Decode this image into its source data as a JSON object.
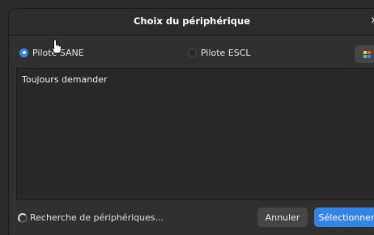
{
  "window": {
    "title": "Choix du périphérique",
    "close_glyph": "×"
  },
  "drivers": {
    "options": [
      {
        "label": "Pilote SANE",
        "selected": true
      },
      {
        "label": "Pilote ESCL",
        "selected": false
      }
    ],
    "apps_icon": "apps-grid-icon",
    "apps_icon_colors": [
      "#f6c343",
      "#e66100",
      "#33d17a",
      "#3584e4"
    ]
  },
  "devices": {
    "items": [
      "Toujours demander"
    ]
  },
  "footer": {
    "status": "Recherche de périphériques...",
    "cancel_label": "Annuler",
    "select_label": "Sélectionner"
  },
  "colors": {
    "accent": "#3584e4"
  }
}
